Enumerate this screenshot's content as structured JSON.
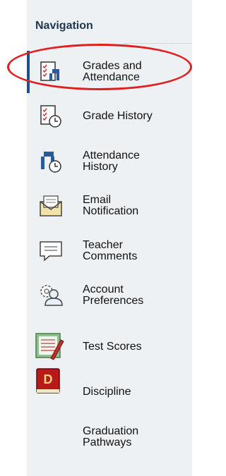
{
  "nav": {
    "heading": "Navigation",
    "items": [
      {
        "id": "grades-attendance",
        "label": "Grades and\nAttendance",
        "icon": "grades-attendance-icon",
        "active": true
      },
      {
        "id": "grade-history",
        "label": "Grade History",
        "icon": "grade-history-icon"
      },
      {
        "id": "attendance-history",
        "label": "Attendance\nHistory",
        "icon": "attendance-history-icon"
      },
      {
        "id": "email-notification",
        "label": "Email\nNotification",
        "icon": "envelope-icon"
      },
      {
        "id": "teacher-comments",
        "label": "Teacher\nComments",
        "icon": "comment-icon"
      },
      {
        "id": "account-preferences",
        "label": "Account\nPreferences",
        "icon": "account-preferences-icon"
      },
      {
        "id": "test-scores",
        "label": "Test Scores",
        "icon": "test-scores-icon"
      },
      {
        "id": "discipline",
        "label": "Discipline",
        "icon": "discipline-icon"
      },
      {
        "id": "graduation-pathways",
        "label": "Graduation\nPathways",
        "icon": ""
      }
    ]
  },
  "annotation": {
    "color": "#e02020"
  }
}
